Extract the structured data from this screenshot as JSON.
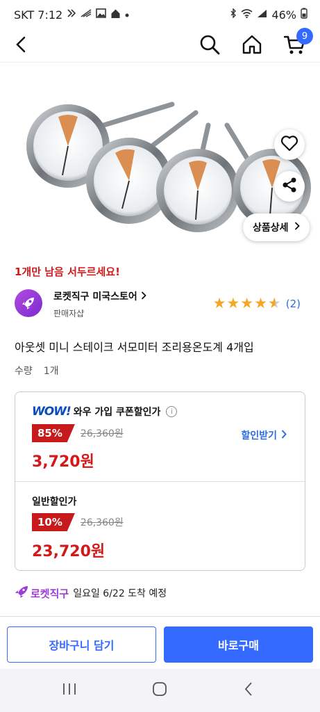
{
  "status_bar": {
    "carrier_time": "SKT 7:12",
    "battery": "46%",
    "icons": [
      "notification-icon",
      "signal-strength-icon",
      "gallery-icon",
      "home-notification-icon",
      "dot-icon",
      "bluetooth-icon",
      "wifi-icon",
      "cell-signal-icon",
      "battery-icon"
    ]
  },
  "nav": {
    "cart_count": "9",
    "icons": [
      "back-arrow-icon",
      "search-icon",
      "home-icon",
      "cart-icon"
    ]
  },
  "product_image": {
    "subject": "four mini steak thermometers",
    "detail_button_label": "상품상세"
  },
  "stock_warning": "1개만 남음 서두르세요!",
  "seller": {
    "name": "로켓직구 미국스토어",
    "subtitle": "판매자샵",
    "rating": 4.5,
    "rating_count": "(2)"
  },
  "product_title": "아웃셋 미니 스테이크 서모미터 조리용온도계 4개입",
  "quantity": {
    "label": "수량",
    "value": "1개"
  },
  "price_wow": {
    "logo": "WOW!",
    "label": "와우 가입 쿠폰할인가",
    "discount": "85%",
    "original_price": "26,360원",
    "final_price": "3,720원",
    "coupon_link": "할인받기"
  },
  "price_regular": {
    "label": "일반할인가",
    "discount": "10%",
    "original_price": "26,360원",
    "final_price": "23,720원"
  },
  "delivery": {
    "badge": "로켓직구",
    "text": "일요일 6/22 도착 예정"
  },
  "actions": {
    "add_to_cart": "장바구니 담기",
    "buy_now": "바로구매"
  },
  "colors": {
    "accent_blue": "#346aff",
    "price_red": "#d21a1a",
    "star": "#f5a623",
    "rocket_purple": "#9b3dd6"
  }
}
